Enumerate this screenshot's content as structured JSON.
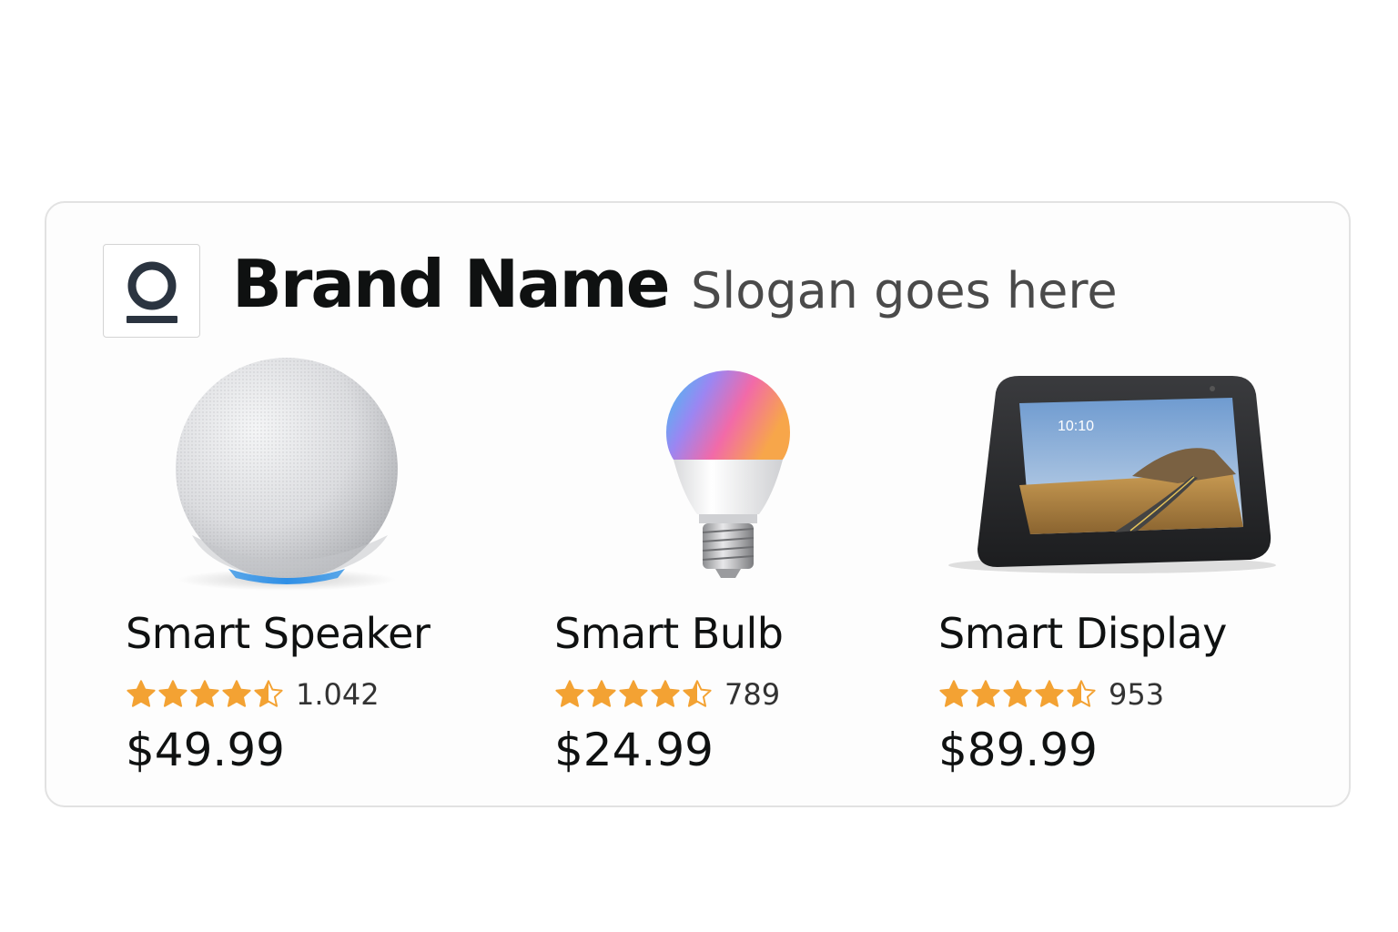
{
  "brand": {
    "name": "Brand Name",
    "slogan": "Slogan goes here",
    "logo_icon": "circle-underline-logo-icon"
  },
  "colors": {
    "star": "#F3A233",
    "text": "#0F1111",
    "slogan": "#4A4A4A",
    "card_border": "#E2E2E2"
  },
  "products": [
    {
      "title": "Smart Speaker",
      "rating": 4.5,
      "review_count": "1.042",
      "price": "$49.99",
      "image_icon": "smart-speaker-image"
    },
    {
      "title": "Smart Bulb",
      "rating": 4.5,
      "review_count": "789",
      "price": "$24.99",
      "image_icon": "smart-bulb-image"
    },
    {
      "title": "Smart Display",
      "rating": 4.5,
      "review_count": "953",
      "price": "$89.99",
      "image_icon": "smart-display-image",
      "screen_time": "10:10"
    }
  ]
}
